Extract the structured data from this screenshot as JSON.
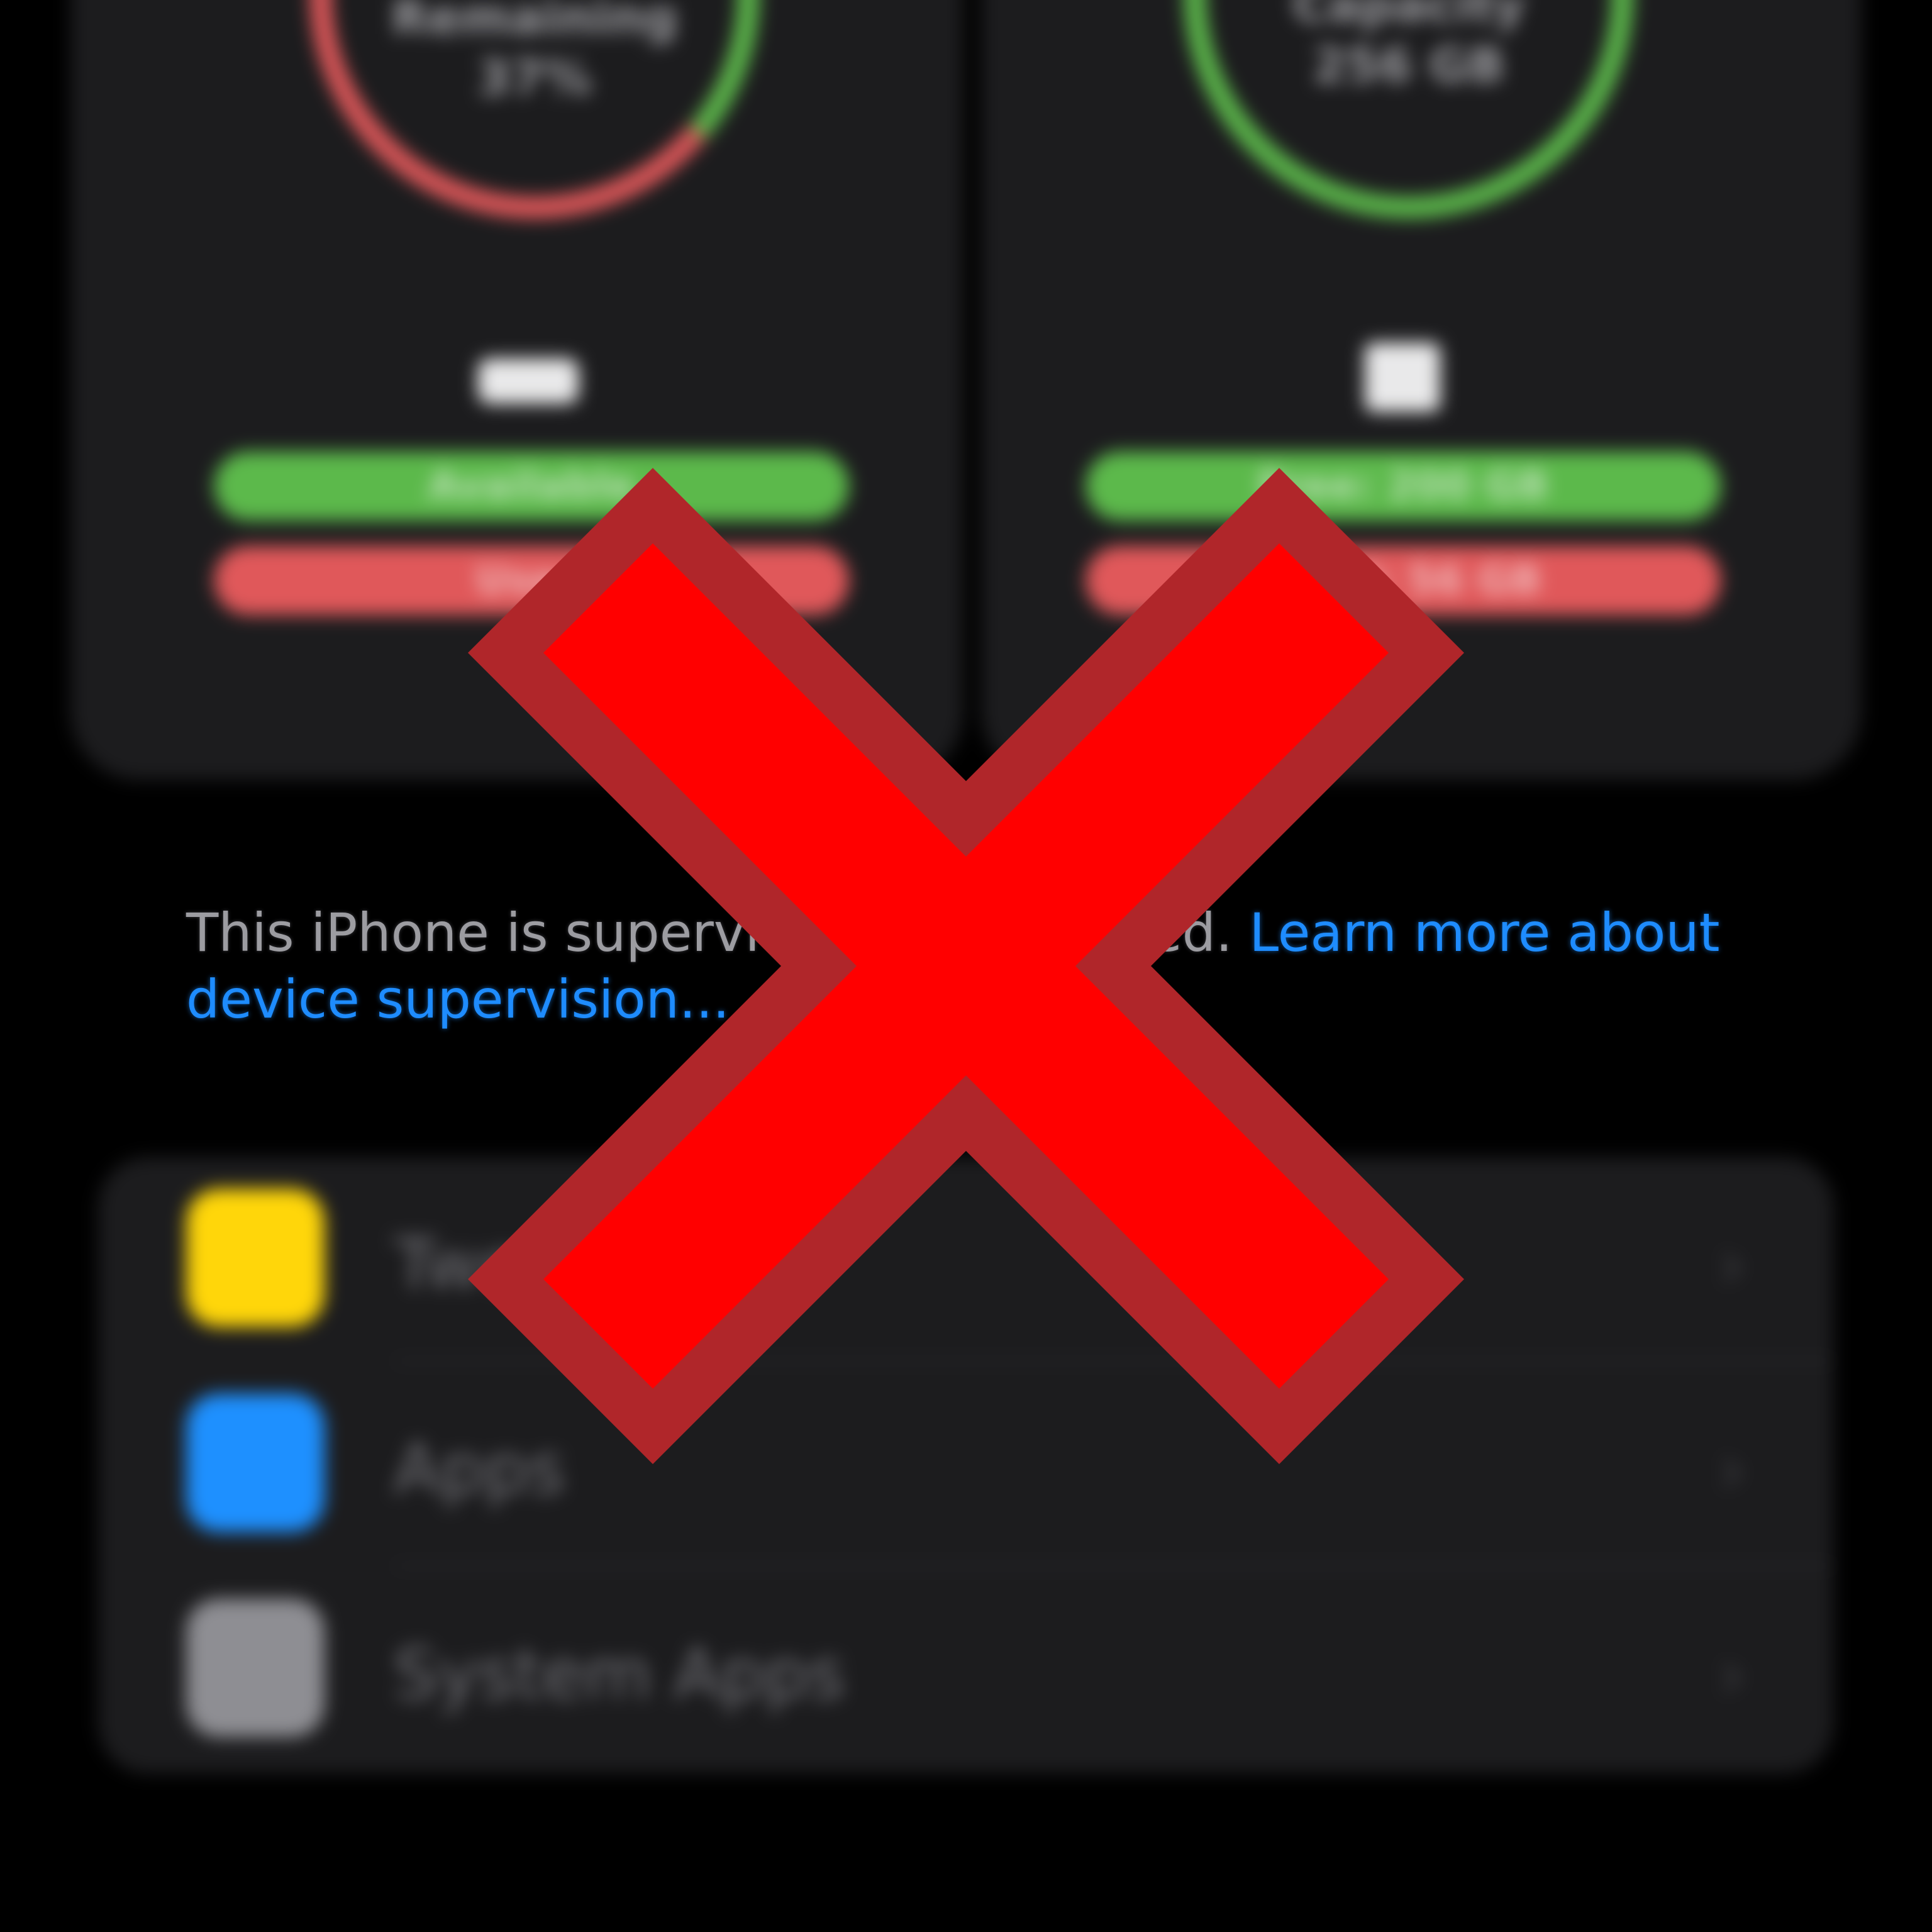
{
  "storage": {
    "left_panel": {
      "ring_label": "Remaining",
      "ring_value": "37%",
      "icon": "memory-chip-icon",
      "available_label": "Available",
      "used_label": "Used",
      "ring_fraction_used": 0.63
    },
    "right_panel": {
      "ring_label": "Capacity",
      "ring_value": "256 GB",
      "icon": "storage-icon",
      "free_label": "Free: 200 GB",
      "used_label": "Used: 56 GB",
      "ring_fraction_used": 0.0
    }
  },
  "supervision_note": {
    "text_start": "This iPhone is supervi",
    "text_end": "ed. ",
    "link_line1": "Learn more about",
    "link_line2": "device supervision..."
  },
  "list": {
    "items": [
      {
        "label": "Tweaks",
        "icon": "tweaks-app-icon",
        "color": "#ffd60a"
      },
      {
        "label": "Apps",
        "icon": "app-store-icon",
        "color": "#1e90ff"
      },
      {
        "label": "System Apps",
        "icon": "system-apps-icon",
        "color": "#8e8e93"
      }
    ]
  },
  "overlay": {
    "icon": "red-x-mark-icon",
    "fill": "#ff0000",
    "outline": "#b0262a"
  },
  "colors": {
    "green": "#5cb94b",
    "red": "#e0585a",
    "link": "#1e8cff",
    "card": "#1c1c1e"
  }
}
